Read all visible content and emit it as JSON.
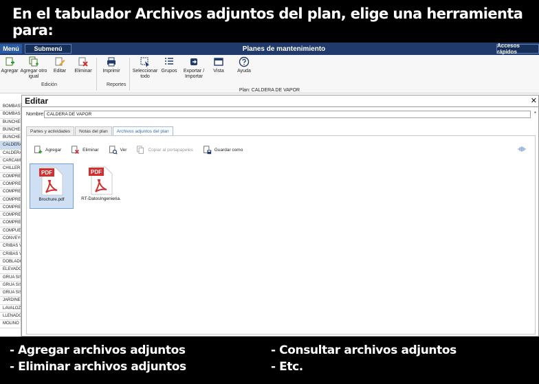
{
  "banner": {
    "text": "En el tabulador Archivos adjuntos del plan, elige una herramienta para:"
  },
  "menubar": {
    "menu": "Menú",
    "submenu": "Submenú",
    "title": "Planes de mantenimiento",
    "quick": "Accesos rápidos"
  },
  "ribbon": {
    "agregar": "Agregar",
    "agregar_otro": "Agregar otro igual",
    "editar": "Editar",
    "eliminar": "Eliminar",
    "group_edicion": "Edición",
    "imprimir": "Imprimir",
    "group_reportes": "Reportes",
    "seleccionar_todo": "Seleccionar todo",
    "grupos": "Grupos",
    "exportar": "Exportar / Importar",
    "vista": "Vista",
    "ayuda": "Ayuda"
  },
  "plan_line": "Plan: CALDERA DE VAPOR",
  "left_list": {
    "items": [
      "BOMBAS",
      "BOMBAS",
      "BUNCHER",
      "BUNCHER",
      "BUNCHER",
      "CALDERA",
      "CALDERA",
      "CARCAMO",
      "CHILLER",
      "COMPRES",
      "COMPRES",
      "COMPRES",
      "COMPRES",
      "COMPRES",
      "COMPRES",
      "COMPRES",
      "COMPUER",
      "CONVEYO",
      "CRIBAS V",
      "CRIBAS V",
      "DOBLADO",
      "ELEVADO",
      "GRUA SIS",
      "GRUA SIS",
      "GRUA SIS",
      "JARDINES",
      "LAVALOZ",
      "LLENADO",
      "MOLINO"
    ]
  },
  "dialog": {
    "title": "Editar",
    "close": "✕",
    "name_label": "Nombre:",
    "name_value": "CALDERA DE VAPOR",
    "required_mark": "*",
    "tabs": [
      "Partes y actividades",
      "Notas del plan",
      "Archivos adjuntos del plan"
    ],
    "toolbar": {
      "agregar": "Agregar",
      "eliminar": "Eliminar",
      "ver": "Ver",
      "copiar": "Copiar al portapapeles",
      "guardar": "Guardar como"
    },
    "files": [
      {
        "name": "Brochure.pdf",
        "badge": "PDF"
      },
      {
        "name": "RT-DatosIngenieria.",
        "badge": "PDF"
      }
    ]
  },
  "bottom": {
    "line1_left": "- Agregar archivos adjuntos",
    "line2_left": "- Eliminar archivos adjuntos",
    "line1_right": "- Consultar archivos adjuntos",
    "line2_right": "- Etc."
  },
  "colors": {
    "menubar": "#1f3a6b",
    "pdf_red": "#d32f2f",
    "selection": "#cfe0f4"
  }
}
